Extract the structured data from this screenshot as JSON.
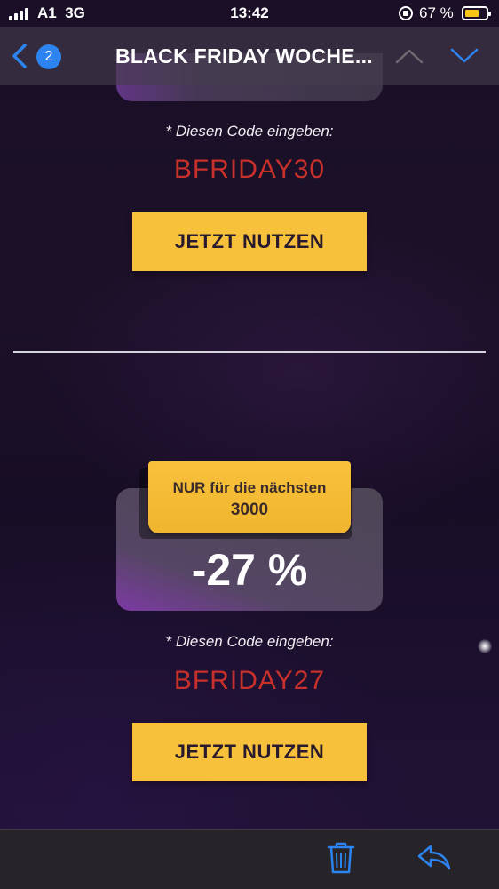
{
  "status_bar": {
    "carrier": "A1",
    "network": "3G",
    "time": "13:42",
    "battery_percent_text": "67 %",
    "battery_level": 0.67,
    "battery_color": "#f5c518"
  },
  "nav": {
    "back_icon": "chevron-left-icon",
    "unread_count": "2",
    "title": "BLACK FRIDAY WOCHE...",
    "prev_icon": "chevron-up-icon",
    "next_icon": "chevron-down-icon",
    "accent_color": "#2d84f0"
  },
  "offer_top": {
    "instruction": "* Diesen Code eingeben:",
    "code": "BFRIDAY30",
    "button_label": "JETZT NUTZEN"
  },
  "offer_bottom": {
    "badge_line1": "NUR für die nächsten",
    "badge_line2": "3000",
    "discount": "-27 %",
    "instruction": "* Diesen Code eingeben:",
    "code": "BFRIDAY27",
    "button_label": "JETZT NUTZEN"
  },
  "toolbar": {
    "trash_icon": "trash-icon",
    "reply_icon": "reply-icon"
  },
  "colors": {
    "code_red": "#c8312b",
    "cta_yellow": "#f8c13c",
    "background_dark": "#1a0f26"
  }
}
